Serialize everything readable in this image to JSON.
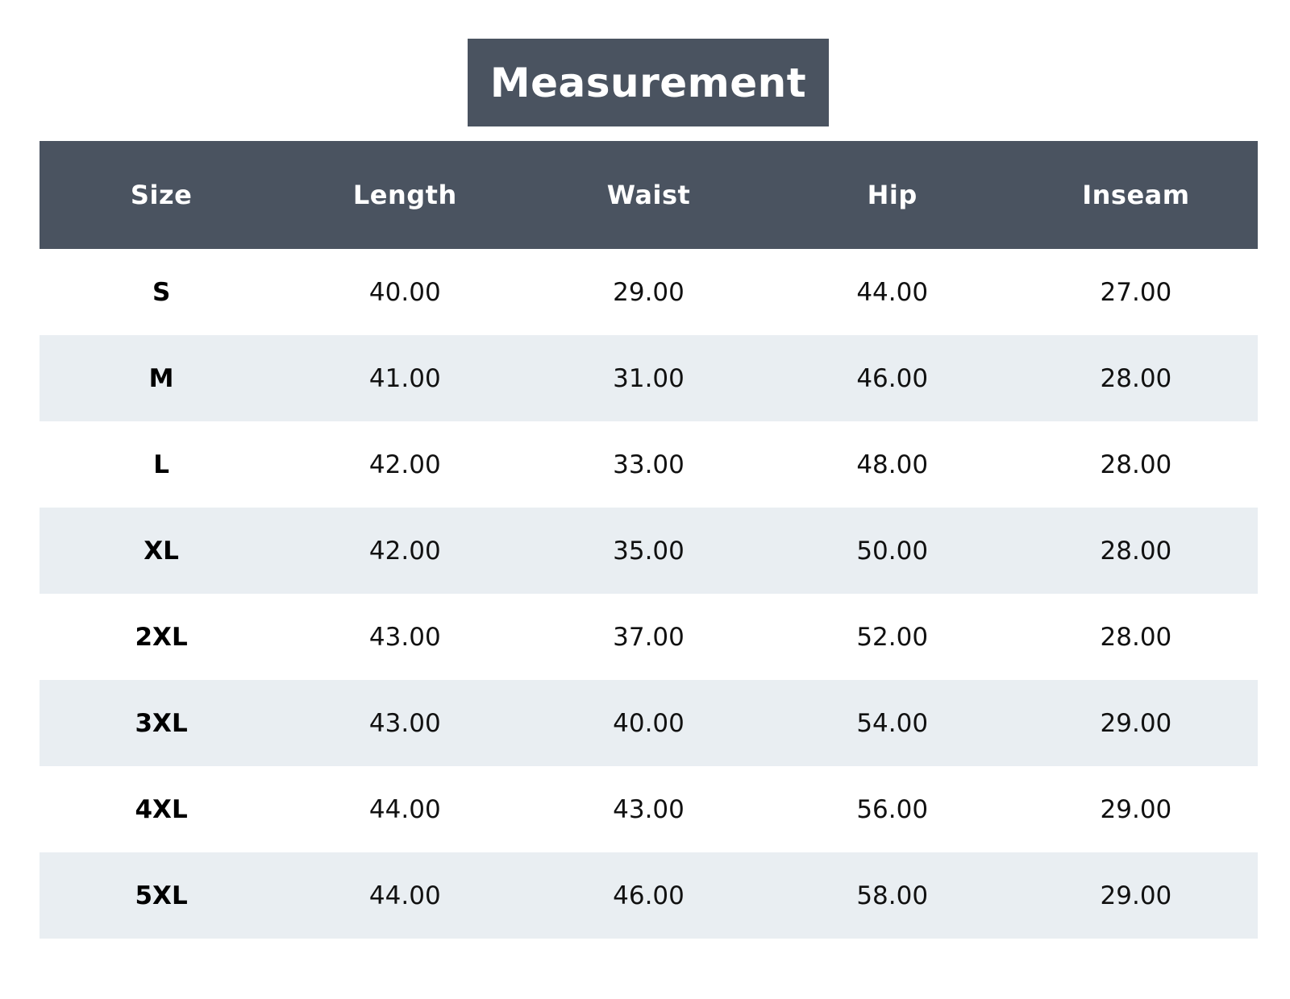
{
  "title": "Measurement",
  "colors": {
    "header_bg": "#4a5360",
    "header_text": "#ffffff",
    "row_alt_bg": "#e9eef2",
    "row_bg": "#ffffff"
  },
  "chart_data": {
    "type": "table",
    "title": "Measurement",
    "columns": [
      "Size",
      "Length",
      "Waist",
      "Hip",
      "Inseam"
    ],
    "rows": [
      [
        "S",
        "40.00",
        "29.00",
        "44.00",
        "27.00"
      ],
      [
        "M",
        "41.00",
        "31.00",
        "46.00",
        "28.00"
      ],
      [
        "L",
        "42.00",
        "33.00",
        "48.00",
        "28.00"
      ],
      [
        "XL",
        "42.00",
        "35.00",
        "50.00",
        "28.00"
      ],
      [
        "2XL",
        "43.00",
        "37.00",
        "52.00",
        "28.00"
      ],
      [
        "3XL",
        "43.00",
        "40.00",
        "54.00",
        "29.00"
      ],
      [
        "4XL",
        "44.00",
        "43.00",
        "56.00",
        "29.00"
      ],
      [
        "5XL",
        "44.00",
        "46.00",
        "58.00",
        "29.00"
      ]
    ]
  }
}
